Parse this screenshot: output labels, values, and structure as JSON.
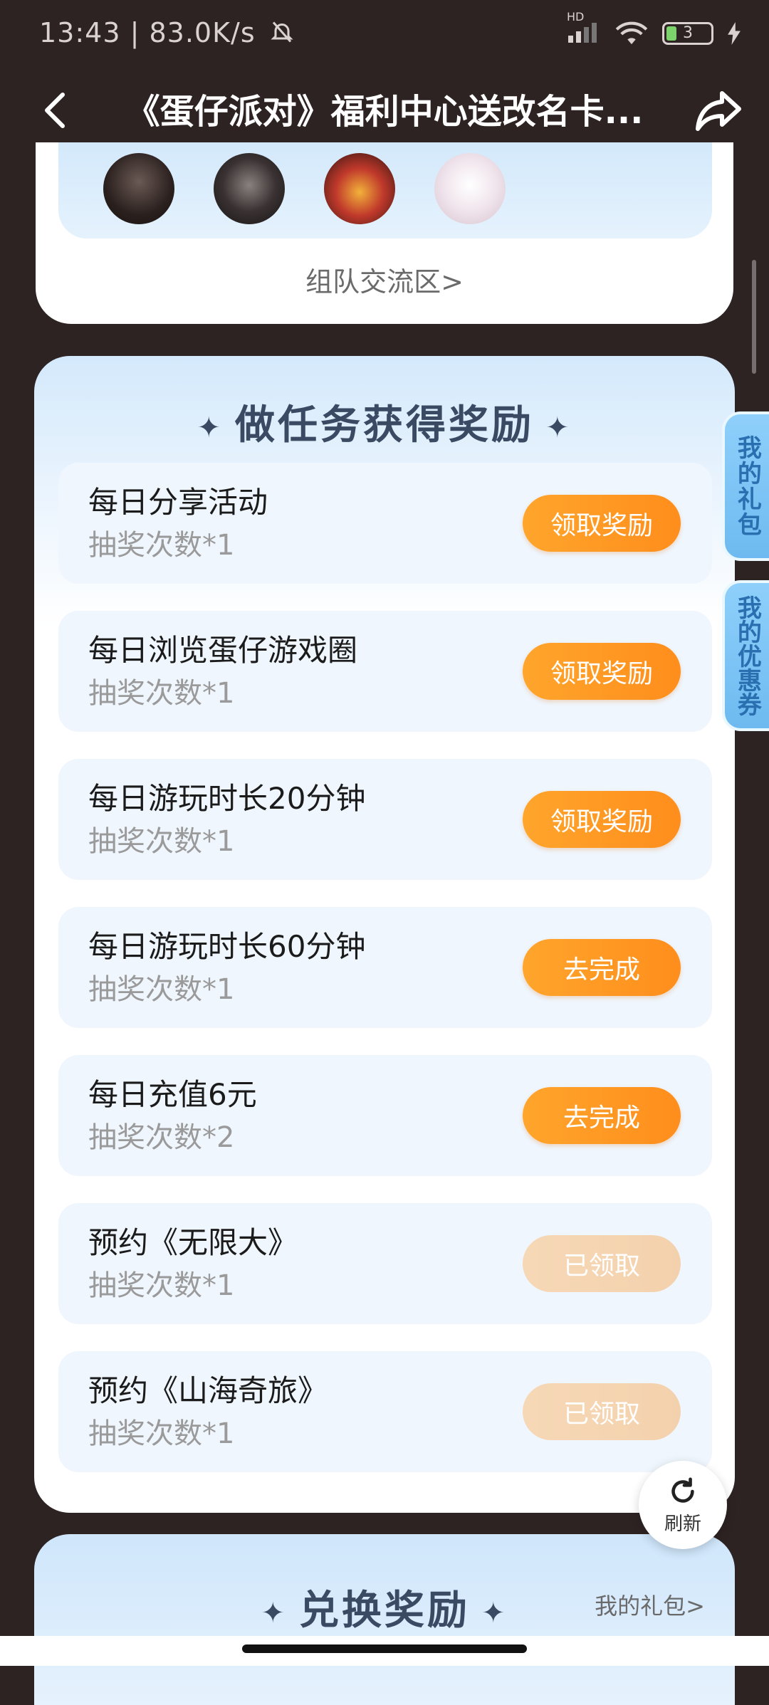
{
  "status_bar": {
    "time": "13:43",
    "speed": "83.0K/s",
    "battery": "3",
    "network": "HD"
  },
  "nav": {
    "title": "《蛋仔派对》福利中心送改名卡..."
  },
  "team": {
    "link": "组队交流区>"
  },
  "tasks": {
    "title": "做任务获得奖励",
    "items": [
      {
        "name": "每日分享活动",
        "sub": "抽奖次数*1",
        "button": "领取奖励"
      },
      {
        "name": "每日浏览蛋仔游戏圈",
        "sub": "抽奖次数*1",
        "button": "领取奖励"
      },
      {
        "name": "每日游玩时长20分钟",
        "sub": "抽奖次数*1",
        "button": "领取奖励"
      },
      {
        "name": "每日游玩时长60分钟",
        "sub": "抽奖次数*1",
        "button": "去完成"
      },
      {
        "name": "每日充值6元",
        "sub": "抽奖次数*2",
        "button": "去完成"
      },
      {
        "name": "预约《无限大》",
        "sub": "抽奖次数*1",
        "button": "已领取"
      },
      {
        "name": "预约《山海奇旅》",
        "sub": "抽奖次数*1",
        "button": "已领取"
      }
    ]
  },
  "side_tabs": {
    "gift": "我的礼包",
    "coupon": "我的优惠券"
  },
  "refresh": {
    "label": "刷新"
  },
  "exchange": {
    "title": "兑换奖励",
    "link": "我的礼包>"
  },
  "colors": {
    "background": "#2e2323",
    "accent_orange": "#ff9520",
    "disabled_orange": "#f5d5b2",
    "card_blue": "#d4e9fb",
    "title_text": "#3b4a63"
  }
}
